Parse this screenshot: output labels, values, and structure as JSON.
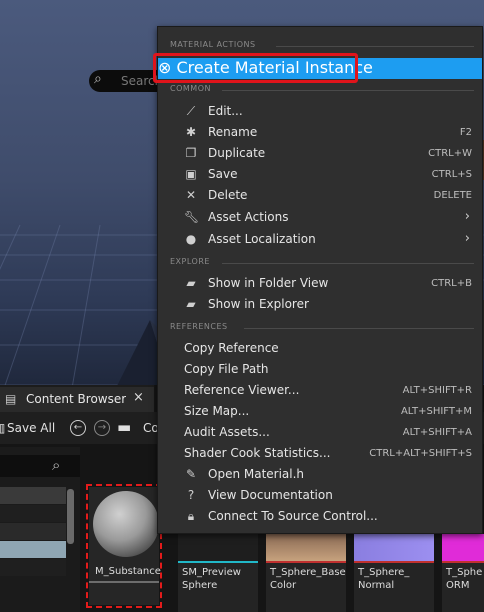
{
  "menu": {
    "sections": {
      "material_actions": "MATERIAL ACTIONS",
      "common": "COMMON",
      "explore": "EXPLORE",
      "references": "REFERENCES"
    },
    "items": {
      "create_material_instance": "Create Material Instance",
      "edit": "Edit...",
      "rename": "Rename",
      "rename_sc": "F2",
      "duplicate": "Duplicate",
      "duplicate_sc": "CTRL+W",
      "save": "Save",
      "save_sc": "CTRL+S",
      "delete": "Delete",
      "delete_sc": "DELETE",
      "asset_actions": "Asset Actions",
      "asset_localization": "Asset Localization",
      "show_in_folder_view": "Show in Folder View",
      "show_in_folder_view_sc": "CTRL+B",
      "show_in_explorer": "Show in Explorer",
      "copy_reference": "Copy Reference",
      "copy_file_path": "Copy File Path",
      "reference_viewer": "Reference Viewer...",
      "reference_viewer_sc": "ALT+SHIFT+R",
      "size_map": "Size Map...",
      "size_map_sc": "ALT+SHIFT+M",
      "audit_assets": "Audit Assets...",
      "audit_assets_sc": "ALT+SHIFT+A",
      "shader_cook_statistics": "Shader Cook Statistics...",
      "shader_cook_statistics_sc": "CTRL+ALT+SHIFT+S",
      "open_material_h": "Open Material.h",
      "view_documentation": "View Documentation",
      "connect_to_source_control": "Connect To Source Control..."
    }
  },
  "content_browser": {
    "tab_label": "Content Browser 1",
    "save_all": "Save All",
    "path_partial": "Co",
    "search_placeholder": "Search",
    "assets": [
      {
        "name": "M_Substance"
      },
      {
        "name_line1": "SM_Preview",
        "name_line2": "Sphere"
      },
      {
        "name_line1": "T_Sphere_Base",
        "name_line2": "Color"
      },
      {
        "name_line1": "T_Sphere_",
        "name_line2": "Normal"
      },
      {
        "name_line1": "T_Sphe",
        "name_line2": "ORM"
      }
    ]
  },
  "colors": {
    "highlight": "#1d9df1",
    "annotation_red": "#e0141b"
  }
}
